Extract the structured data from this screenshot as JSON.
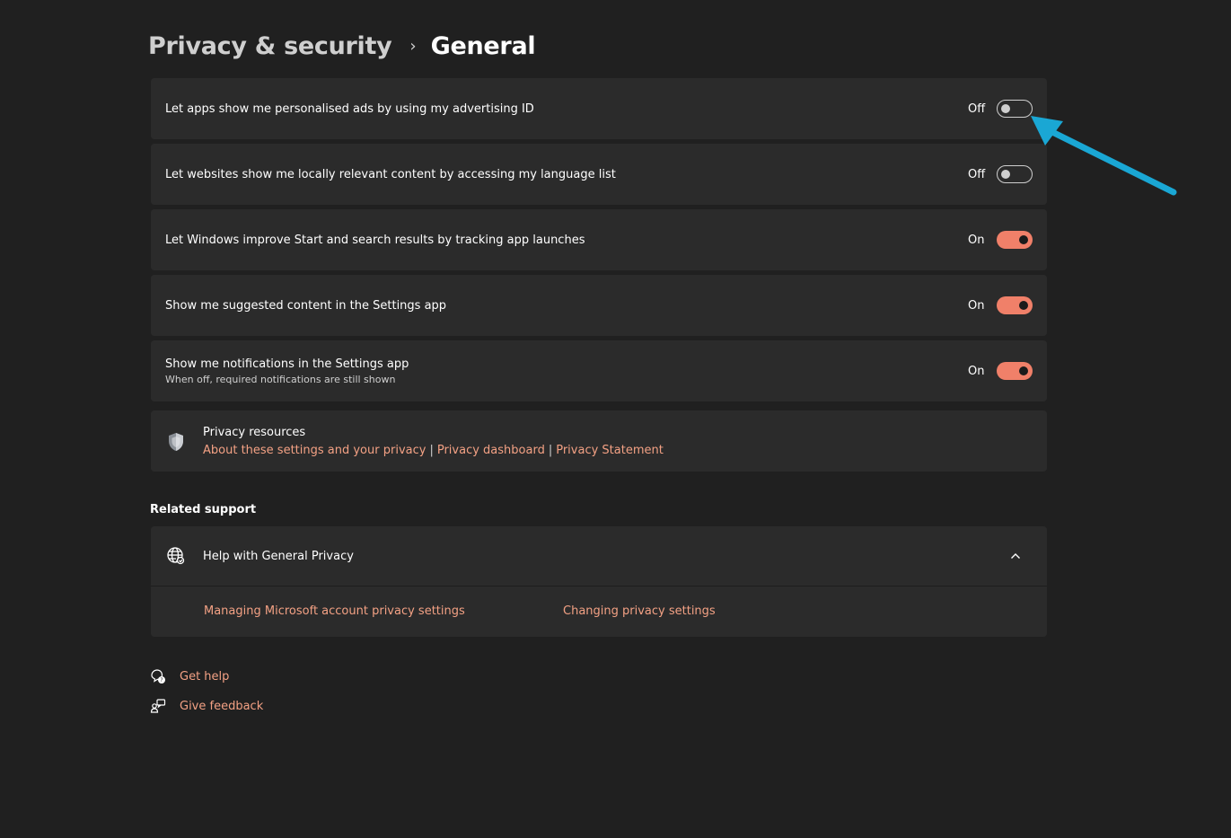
{
  "breadcrumb": {
    "parent": "Privacy & security",
    "separator": "›",
    "current": "General"
  },
  "settings": [
    {
      "label": "Let apps show me personalised ads by using my advertising ID",
      "state": "Off",
      "on": false
    },
    {
      "label": "Let websites show me locally relevant content by accessing my language list",
      "state": "Off",
      "on": false
    },
    {
      "label": "Let Windows improve Start and search results by tracking app launches",
      "state": "On",
      "on": true
    },
    {
      "label": "Show me suggested content in the Settings app",
      "state": "On",
      "on": true
    },
    {
      "label": "Show me notifications in the Settings app",
      "sublabel": "When off, required notifications are still shown",
      "state": "On",
      "on": true
    }
  ],
  "privacy_resources": {
    "title": "Privacy resources",
    "links": [
      "About these settings and your privacy",
      "Privacy dashboard",
      "Privacy Statement"
    ],
    "separator": "|",
    "icon": "shield-icon"
  },
  "related_support": {
    "title": "Related support",
    "help_title": "Help with General Privacy",
    "icon": "globe-icon",
    "links": [
      "Managing Microsoft account privacy settings",
      "Changing privacy settings"
    ]
  },
  "footer": {
    "get_help": "Get help",
    "give_feedback": "Give feedback"
  },
  "colors": {
    "background": "#202020",
    "card": "#2b2b2b",
    "accent": "#f08069",
    "link": "#f3a184",
    "annotation_arrow": "#1aa7d4"
  }
}
